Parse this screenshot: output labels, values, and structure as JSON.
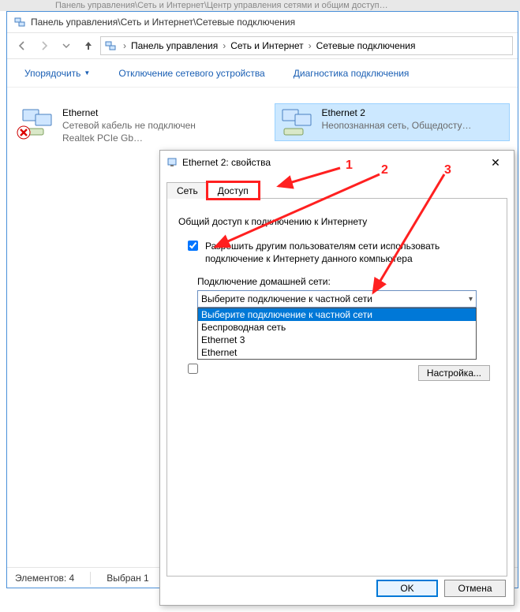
{
  "bg_window_title": "Панель управления\\Сеть и Интернет\\Центр управления сетями и общим доступ…",
  "explorer_title": "Панель управления\\Сеть и Интернет\\Сетевые подключения",
  "breadcrumb": {
    "items": [
      "Панель управления",
      "Сеть и Интернет",
      "Сетевые подключения"
    ]
  },
  "toolbar": {
    "organize": "Упорядочить",
    "disable": "Отключение сетевого устройства",
    "diagnose": "Диагностика подключения"
  },
  "connections": [
    {
      "name": "Ethernet",
      "line2": "Сетевой кабель не подключен",
      "line3": "Realtek PCIe Gb…"
    },
    {
      "name": "Ethernet 2",
      "line2": "Неопознанная сеть, Общедосту…",
      "line3": ""
    }
  ],
  "status": {
    "count_label": "Элементов: 4",
    "selected_label": "Выбран 1"
  },
  "dialog": {
    "title": "Ethernet 2: свойства",
    "tabs": {
      "network": "Сеть",
      "sharing": "Доступ"
    },
    "group_title": "Общий доступ к подключению к Интернету",
    "allow_label": "Разрешить другим пользователям сети использовать подключение к Интернету данного компьютера",
    "home_label": "Подключение домашней сети:",
    "combo_selected": "Выберите подключение к частной сети",
    "combo_options": [
      "Выберите подключение к частной сети",
      "Беспроводная сеть",
      "Ethernet 3",
      "Ethernet"
    ],
    "allow_control_label": "",
    "settings_btn": "Настройка...",
    "ok": "OK",
    "cancel": "Отмена"
  },
  "annotations": {
    "n1": "1",
    "n2": "2",
    "n3": "3"
  }
}
